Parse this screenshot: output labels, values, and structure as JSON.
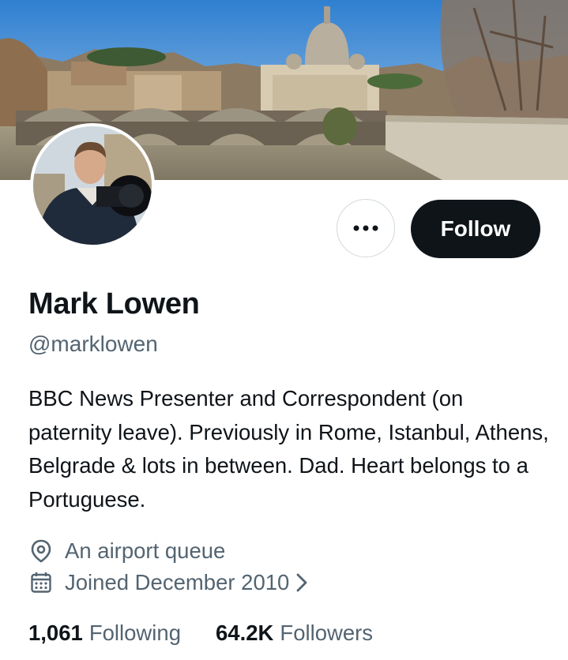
{
  "profile": {
    "name": "Mark Lowen",
    "handle": "@marklowen",
    "bio": "BBC News Presenter and Correspondent (on paternity leave). Previously in Rome, Istanbul, Athens, Belgrade & lots in between. Dad. Heart belongs to a Portuguese.",
    "location": "An airport queue",
    "joined": "Joined December 2010"
  },
  "actions": {
    "follow_label": "Follow",
    "more_icon": "more-horizontal-icon"
  },
  "stats": {
    "following_count": "1,061",
    "following_label": "Following",
    "followers_count": "64.2K",
    "followers_label": "Followers"
  },
  "icons": {
    "location": "location-pin-icon",
    "calendar": "calendar-icon",
    "chevron": "chevron-right-icon"
  },
  "colors": {
    "primary_text": "#0f1419",
    "secondary_text": "#536471",
    "button_bg": "#0f1419",
    "border": "#cfd9de"
  }
}
